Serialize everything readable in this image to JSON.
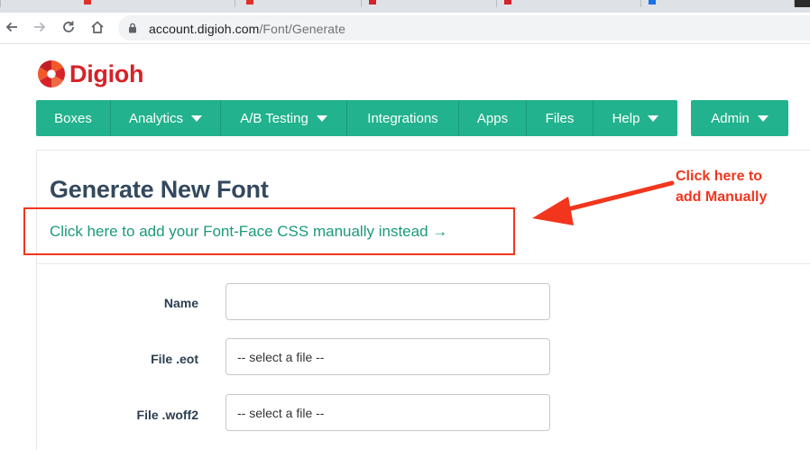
{
  "browser": {
    "url_host": "account.digioh.com",
    "url_path": "/Font/Generate"
  },
  "logo": {
    "text": "Digioh"
  },
  "nav": {
    "items": [
      {
        "label": "Boxes",
        "has_caret": false
      },
      {
        "label": "Analytics",
        "has_caret": true
      },
      {
        "label": "A/B Testing",
        "has_caret": true
      },
      {
        "label": "Integrations",
        "has_caret": false
      },
      {
        "label": "Apps",
        "has_caret": false
      },
      {
        "label": "Files",
        "has_caret": false
      },
      {
        "label": "Help",
        "has_caret": true
      }
    ],
    "admin_label": "Admin",
    "color": "#22b28d"
  },
  "page": {
    "title": "Generate New Font",
    "manual_link": "Click here to add your Font-Face CSS manually instead →"
  },
  "annotation": {
    "line1": "Click here to",
    "line2": "add Manually",
    "color": "#f1361d"
  },
  "form": {
    "name_label": "Name",
    "name_value": "",
    "eot_label": "File .eot",
    "eot_placeholder": "-- select a file --",
    "woff2_label": "File .woff2",
    "woff2_placeholder": "-- select a file --"
  }
}
